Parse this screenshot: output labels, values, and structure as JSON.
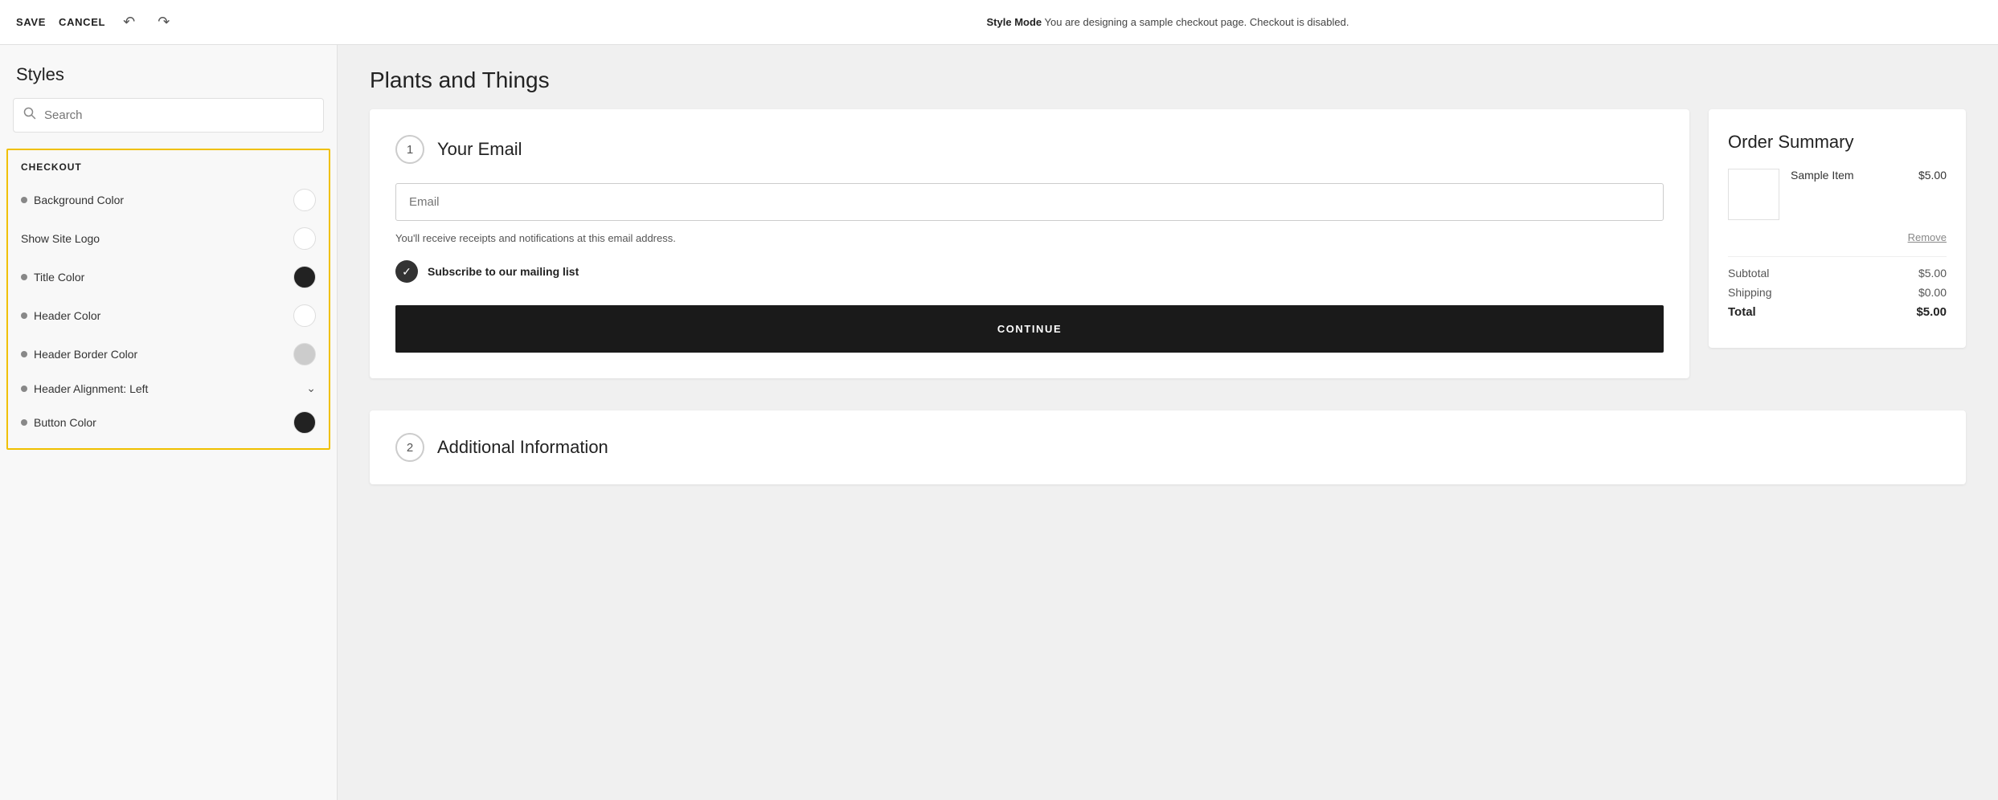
{
  "topbar": {
    "save_label": "SAVE",
    "cancel_label": "CANCEL",
    "mode_label": "Style Mode",
    "mode_description": "You are designing a sample checkout page. Checkout is disabled."
  },
  "sidebar": {
    "title": "Styles",
    "search_placeholder": "Search",
    "checkout_section": {
      "header": "CHECKOUT",
      "items": [
        {
          "label": "Background Color",
          "has_dot": true,
          "color_type": "white",
          "has_arrow": false
        },
        {
          "label": "Show Site Logo",
          "has_dot": false,
          "color_type": "white",
          "has_arrow": false
        },
        {
          "label": "Title Color",
          "has_dot": true,
          "color_type": "dark",
          "has_arrow": false
        },
        {
          "label": "Header Color",
          "has_dot": true,
          "color_type": "white",
          "has_arrow": false
        },
        {
          "label": "Header Border Color",
          "has_dot": true,
          "color_type": "light-gray",
          "has_arrow": false
        },
        {
          "label": "Header Alignment: Left",
          "has_dot": true,
          "color_type": null,
          "has_arrow": true
        },
        {
          "label": "Button Color",
          "has_dot": true,
          "color_type": "dark",
          "has_arrow": false
        }
      ]
    }
  },
  "main": {
    "page_title": "Plants and Things",
    "step1": {
      "number": "1",
      "title": "Your Email",
      "email_placeholder": "Email",
      "email_notice": "You'll receive receipts and notifications at this email address.",
      "subscribe_label": "Subscribe to our mailing list",
      "continue_btn": "CONTINUE"
    },
    "step2": {
      "number": "2",
      "title": "Additional Information"
    },
    "order_summary": {
      "title": "Order Summary",
      "item_name": "Sample Item",
      "item_price": "$5.00",
      "remove_label": "Remove",
      "subtotal_label": "Subtotal",
      "subtotal_value": "$5.00",
      "shipping_label": "Shipping",
      "shipping_value": "$0.00",
      "total_label": "Total",
      "total_value": "$5.00"
    }
  }
}
